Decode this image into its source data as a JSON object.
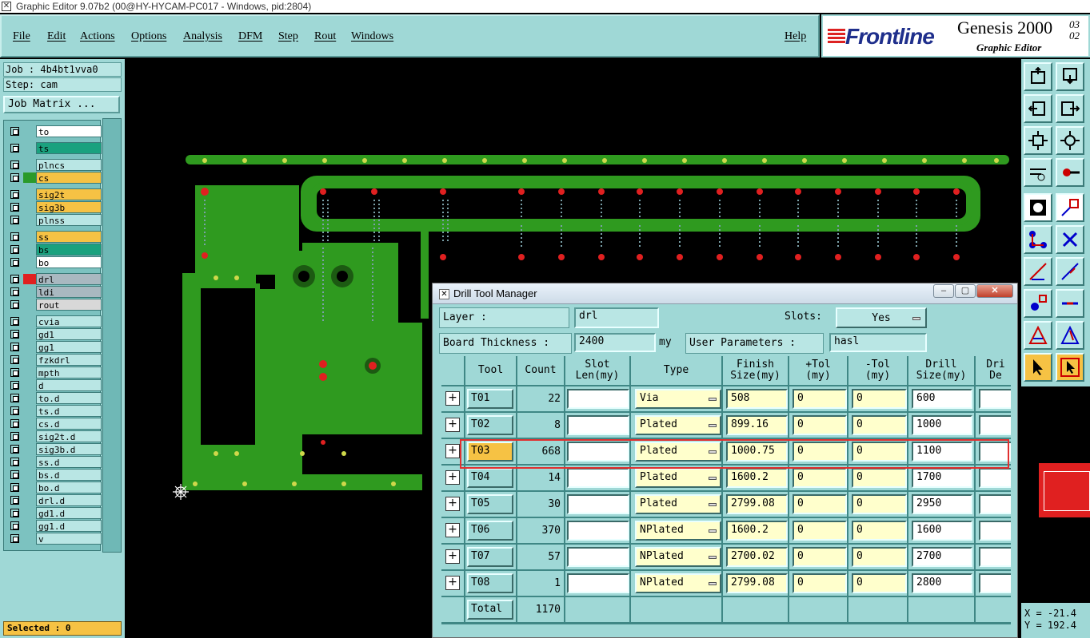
{
  "window": {
    "title": "Graphic Editor 9.07b2 (00@HY-HYCAM-PC017 - Windows, pid:2804)"
  },
  "menu": {
    "items": [
      "File",
      "Edit",
      "Actions",
      "Options",
      "Analysis",
      "DFM",
      "Step",
      "Rout",
      "Windows"
    ],
    "help": "Help"
  },
  "brand": {
    "logo": "Frontline",
    "product": "Genesis 2000",
    "subtitle": "Graphic Editor",
    "version_top": "03",
    "version_bottom": "02"
  },
  "job": {
    "job_line": "Job : 4b4bt1vva0",
    "step_line": "Step: cam",
    "matrix_button": "Job Matrix ..."
  },
  "layers": [
    {
      "name": "to",
      "color": "#ffffff",
      "swatch": ""
    },
    {
      "name": "ts",
      "color": "#1aa17e",
      "swatch": ""
    },
    {
      "name": "plncs",
      "color": "#b9e6e4",
      "swatch": ""
    },
    {
      "name": "cs",
      "color": "#f6c244",
      "swatch": "#2a9a2a"
    },
    {
      "name": "sig2t",
      "color": "#f6c244",
      "swatch": ""
    },
    {
      "name": "sig3b",
      "color": "#f6c244",
      "swatch": ""
    },
    {
      "name": "plnss",
      "color": "#b9e6e4",
      "swatch": ""
    },
    {
      "name": "ss",
      "color": "#f6c244",
      "swatch": ""
    },
    {
      "name": "bs",
      "color": "#1aa17e",
      "swatch": ""
    },
    {
      "name": "bo",
      "color": "#ffffff",
      "swatch": ""
    },
    {
      "name": "drl",
      "color": "#a9b8c0",
      "swatch": "#e02020"
    },
    {
      "name": "ldi",
      "color": "#a9b8c0",
      "swatch": ""
    },
    {
      "name": "rout",
      "color": "#d8d8d8",
      "swatch": ""
    },
    {
      "name": "cvia",
      "color": "#b9e6e4",
      "swatch": ""
    },
    {
      "name": "gd1",
      "color": "#b9e6e4",
      "swatch": ""
    },
    {
      "name": "gg1",
      "color": "#b9e6e4",
      "swatch": ""
    },
    {
      "name": "fzkdrl",
      "color": "#b9e6e4",
      "swatch": ""
    },
    {
      "name": "mpth",
      "color": "#b9e6e4",
      "swatch": ""
    },
    {
      "name": "d",
      "color": "#b9e6e4",
      "swatch": ""
    },
    {
      "name": "to.d",
      "color": "#b9e6e4",
      "swatch": ""
    },
    {
      "name": "ts.d",
      "color": "#b9e6e4",
      "swatch": ""
    },
    {
      "name": "cs.d",
      "color": "#b9e6e4",
      "swatch": ""
    },
    {
      "name": "sig2t.d",
      "color": "#b9e6e4",
      "swatch": ""
    },
    {
      "name": "sig3b.d",
      "color": "#b9e6e4",
      "swatch": ""
    },
    {
      "name": "ss.d",
      "color": "#b9e6e4",
      "swatch": ""
    },
    {
      "name": "bs.d",
      "color": "#b9e6e4",
      "swatch": ""
    },
    {
      "name": "bo.d",
      "color": "#b9e6e4",
      "swatch": ""
    },
    {
      "name": "drl.d",
      "color": "#b9e6e4",
      "swatch": ""
    },
    {
      "name": "gd1.d",
      "color": "#b9e6e4",
      "swatch": ""
    },
    {
      "name": "gg1.d",
      "color": "#b9e6e4",
      "swatch": ""
    },
    {
      "name": "v",
      "color": "#b9e6e4",
      "swatch": ""
    }
  ],
  "status": {
    "selected": "Selected : 0",
    "x": "X = -21.4",
    "y": "Y = 192.4"
  },
  "dtm": {
    "title": "Drill Tool Manager",
    "layer_label": "Layer          :",
    "layer_value": "drl",
    "slots_label": "Slots:",
    "slots_value": "Yes",
    "thickness_label": "Board Thickness :",
    "thickness_value": "2400",
    "thickness_unit": "my",
    "user_params_label": "User Parameters :",
    "user_params_value": "hasl",
    "columns": [
      "Tool",
      "Count",
      "Slot\nLen(my)",
      "Type",
      "Finish\nSize(my)",
      "+Tol\n(my)",
      "-Tol\n(my)",
      "Drill\nSize(my)",
      "Dri\nDe"
    ],
    "rows": [
      {
        "tool": "T01",
        "count": "22",
        "slot": "",
        "type": "Via",
        "finish": "508",
        "ptol": "0",
        "ntol": "0",
        "drill": "600"
      },
      {
        "tool": "T02",
        "count": "8",
        "slot": "",
        "type": "Plated",
        "finish": "899.16",
        "ptol": "0",
        "ntol": "0",
        "drill": "1000"
      },
      {
        "tool": "T03",
        "count": "668",
        "slot": "",
        "type": "Plated",
        "finish": "1000.75",
        "ptol": "0",
        "ntol": "0",
        "drill": "1100"
      },
      {
        "tool": "T04",
        "count": "14",
        "slot": "",
        "type": "Plated",
        "finish": "1600.2",
        "ptol": "0",
        "ntol": "0",
        "drill": "1700"
      },
      {
        "tool": "T05",
        "count": "30",
        "slot": "",
        "type": "Plated",
        "finish": "2799.08",
        "ptol": "0",
        "ntol": "0",
        "drill": "2950"
      },
      {
        "tool": "T06",
        "count": "370",
        "slot": "",
        "type": "NPlated",
        "finish": "1600.2",
        "ptol": "0",
        "ntol": "0",
        "drill": "1600"
      },
      {
        "tool": "T07",
        "count": "57",
        "slot": "",
        "type": "NPlated",
        "finish": "2700.02",
        "ptol": "0",
        "ntol": "0",
        "drill": "2700"
      },
      {
        "tool": "T08",
        "count": "1",
        "slot": "",
        "type": "NPlated",
        "finish": "2799.08",
        "ptol": "0",
        "ntol": "0",
        "drill": "2800"
      }
    ],
    "total_label": "Total",
    "total_count": "1170"
  }
}
